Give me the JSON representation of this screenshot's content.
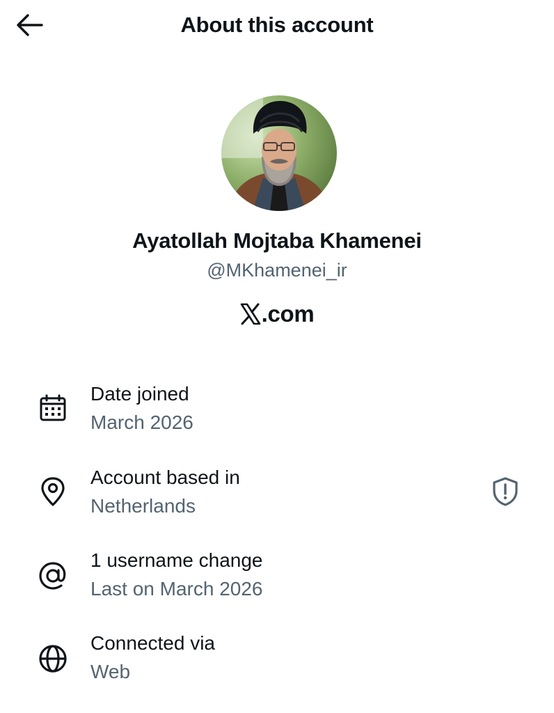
{
  "header": {
    "title": "About this account",
    "back_icon": "arrow-left-icon"
  },
  "profile": {
    "display_name": "Ayatollah Mojtaba Khamenei",
    "handle": "@MKhamenei_ir",
    "brand_suffix": ".com"
  },
  "rows": [
    {
      "icon": "calendar-icon",
      "label": "Date joined",
      "value": "March 2026"
    },
    {
      "icon": "location-pin-icon",
      "label": "Account based in",
      "value": "Netherlands",
      "side_icon": "shield-alert-icon"
    },
    {
      "icon": "at-sign-icon",
      "label": "1 username change",
      "value": "Last on March 2026"
    },
    {
      "icon": "globe-icon",
      "label": "Connected via",
      "value": "Web"
    }
  ],
  "colors": {
    "text_primary": "#0f1419",
    "text_secondary": "#536471",
    "background": "#ffffff"
  }
}
